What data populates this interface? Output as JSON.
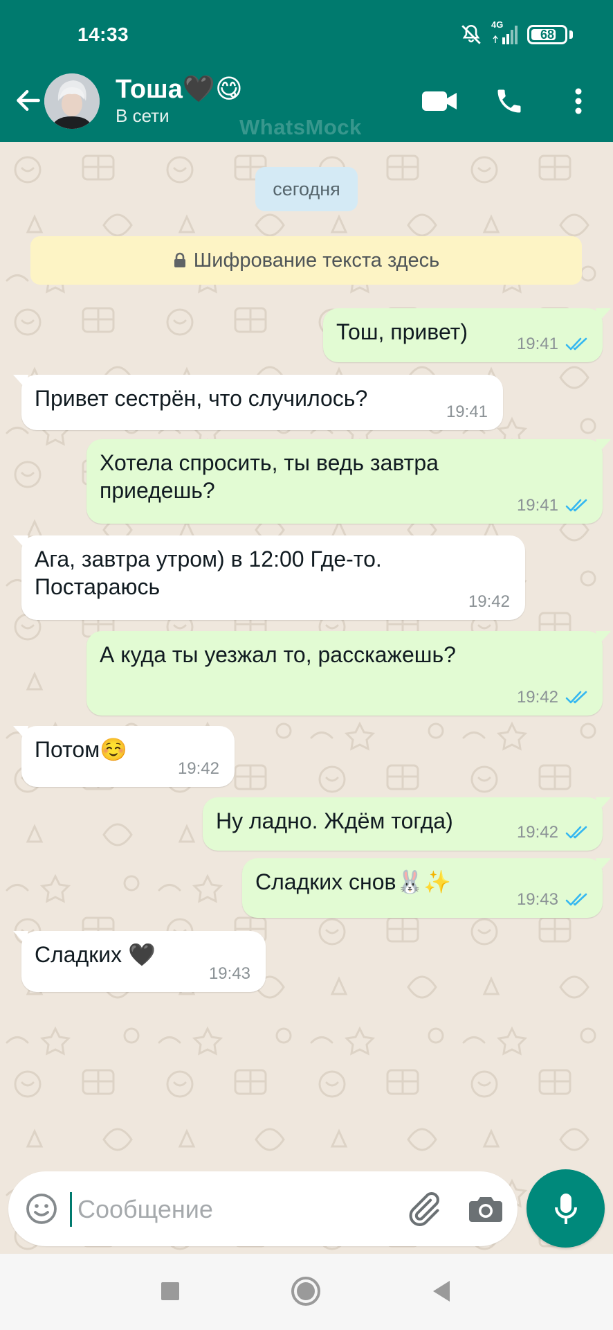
{
  "status_bar": {
    "time": "14:33",
    "network": "4G",
    "battery": "68",
    "battery_level_percent": 68
  },
  "header": {
    "contact_name": "Тоша🖤😋",
    "contact_status": "В сети",
    "watermark": "WhatsMock"
  },
  "chat": {
    "date_chip": "сегодня",
    "encryption_notice": "Шифрование текста здесь",
    "messages": [
      {
        "direction": "out",
        "lines": [
          "Тош, привет)"
        ],
        "time": "19:41",
        "read": true
      },
      {
        "direction": "in",
        "lines": [
          "Привет сестрён, что случилось?"
        ],
        "time": "19:41"
      },
      {
        "direction": "out",
        "lines": [
          "Хотела спросить, ты ведь завтра",
          "приедешь?"
        ],
        "time": "19:41",
        "read": true
      },
      {
        "direction": "in",
        "lines": [
          "Ага, завтра утром) в 12:00 Где-то.",
          "Постараюсь"
        ],
        "time": "19:42"
      },
      {
        "direction": "out",
        "lines": [
          "А куда ты уезжал то, расскажешь?"
        ],
        "time": "19:42",
        "read": true
      },
      {
        "direction": "in",
        "lines": [
          "Потом☺️"
        ],
        "time": "19:42"
      },
      {
        "direction": "out",
        "lines": [
          "Ну ладно. Ждём тогда)"
        ],
        "time": "19:42",
        "read": true
      },
      {
        "direction": "out",
        "lines": [
          "Сладких снов🐰✨"
        ],
        "time": "19:43",
        "read": true
      },
      {
        "direction": "in",
        "lines": [
          "Сладких 🖤"
        ],
        "time": "19:43"
      }
    ]
  },
  "input": {
    "placeholder": "Сообщение",
    "value": ""
  },
  "icons": {
    "back": "arrow-left-icon",
    "video": "video-camera-icon",
    "call": "phone-icon",
    "menu": "more-vertical-icon",
    "emoji": "smiley-icon",
    "attach": "paperclip-icon",
    "camera": "camera-icon",
    "mic": "microphone-icon",
    "lock": "lock-icon",
    "read_receipt": "double-check-icon"
  },
  "colors": {
    "header": "#007a6e",
    "outgoing_bubble": "#e2fbd3",
    "incoming_bubble": "#ffffff",
    "read_ticks": "#34b7f1",
    "mic_button": "#00897b"
  }
}
